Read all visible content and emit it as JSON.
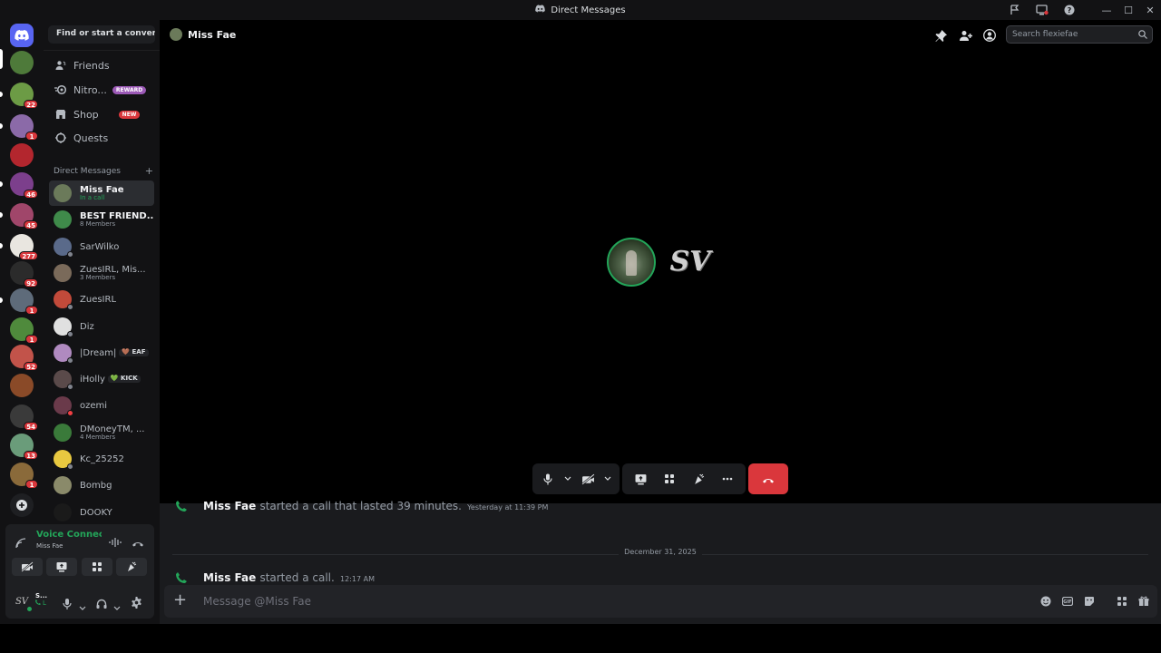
{
  "window": {
    "title": "Direct Messages",
    "minimize": "—",
    "maximize": "☐",
    "close": "✕"
  },
  "guilds": [
    {
      "badge": "",
      "color": "#4e7a3a"
    },
    {
      "badge": "22",
      "color": "#6c9b45"
    },
    {
      "badge": "1",
      "color": "#8b6aa8"
    },
    {
      "badge": "",
      "color": "#b3262e"
    },
    {
      "badge": "46",
      "color": "#7c3f8c"
    },
    {
      "badge": "45",
      "color": "#a0466a"
    },
    {
      "badge": "277",
      "color": "#e9e6e0"
    },
    {
      "badge": "92",
      "color": "#2b2b2b"
    },
    {
      "badge": "1",
      "color": "#5e6b7a"
    },
    {
      "badge": "1",
      "color": "#4f8a3c"
    },
    {
      "badge": "52",
      "color": "#c2534a"
    },
    {
      "badge": "",
      "color": "#8a4a28"
    },
    {
      "badge": "54",
      "color": "#3a3a3a"
    },
    {
      "badge": "13",
      "color": "#6a9c7a"
    },
    {
      "badge": "1",
      "color": "#8a6a3a"
    }
  ],
  "sidebar": {
    "search_label": "Find or start a convers...",
    "nav": {
      "friends": "Friends",
      "nitro": "Nitro...",
      "nitro_pill": "REWARD",
      "shop": "Shop",
      "shop_pill": "NEW",
      "quests": "Quests"
    },
    "dm_header": "Direct Messages",
    "dm_add": "+",
    "dms": [
      {
        "name": "Miss Fae",
        "sub": "In a call",
        "color": "#6b7a5a",
        "status": "",
        "tag": ""
      },
      {
        "name": "BEST FRIEND...",
        "sub": "8 Members",
        "color": "#3f8a4a",
        "status": "",
        "tag": ""
      },
      {
        "name": "SarWilko",
        "sub": "",
        "color": "#5a6a8a",
        "status": "#80848e",
        "tag": ""
      },
      {
        "name": "ZuesIRL, Mis...",
        "sub": "3 Members",
        "color": "#7a6a5a",
        "status": "",
        "tag": ""
      },
      {
        "name": "ZuesIRL",
        "sub": "",
        "color": "#c24a3a",
        "status": "#80848e",
        "tag": ""
      },
      {
        "name": "Diz",
        "sub": "",
        "color": "#e0e0e0",
        "status": "#80848e",
        "tag": ""
      },
      {
        "name": "|Dream|",
        "sub": "",
        "color": "#b08ac0",
        "status": "#80848e",
        "tag": "🤎 EAF"
      },
      {
        "name": "iHolly",
        "sub": "",
        "color": "#5a4a4a",
        "status": "#80848e",
        "tag": "💚 KICK"
      },
      {
        "name": "ozemi",
        "sub": "",
        "color": "#6a3a4a",
        "status": "#f23f43",
        "tag": ""
      },
      {
        "name": "DMoneyTM, ...",
        "sub": "4 Members",
        "color": "#3a7a3a",
        "status": "",
        "tag": ""
      },
      {
        "name": "Kc_25252",
        "sub": "",
        "color": "#e8c840",
        "status": "#80848e",
        "tag": ""
      },
      {
        "name": "Bombg",
        "sub": "",
        "color": "#8a8a6a",
        "status": "",
        "tag": ""
      },
      {
        "name": "DOOKY",
        "sub": "",
        "color": "#1a1a1a",
        "status": "",
        "tag": ""
      }
    ]
  },
  "voice": {
    "title": "Voice Connected",
    "sub": "Miss Fae"
  },
  "user": {
    "short": "S...",
    "sub": "L"
  },
  "main": {
    "header_name": "Miss Fae",
    "search_placeholder": "Search flexiefae",
    "call_signature": "SV",
    "messages": [
      {
        "who": "Miss Fae",
        "text": "started a call that lasted 39 minutes.",
        "time": "Yesterday at 11:39 PM"
      },
      {
        "who": "Miss Fae",
        "text": "started a call.",
        "time": "12:17 AM"
      }
    ],
    "date_divider": "December 31, 2025",
    "composer_placeholder": "Message @Miss Fae"
  },
  "colors": {
    "accent": "#5865f2",
    "green": "#23a559",
    "red": "#da373c",
    "nitro_pill": "#9b59b6",
    "shop_pill": "#da373c"
  }
}
